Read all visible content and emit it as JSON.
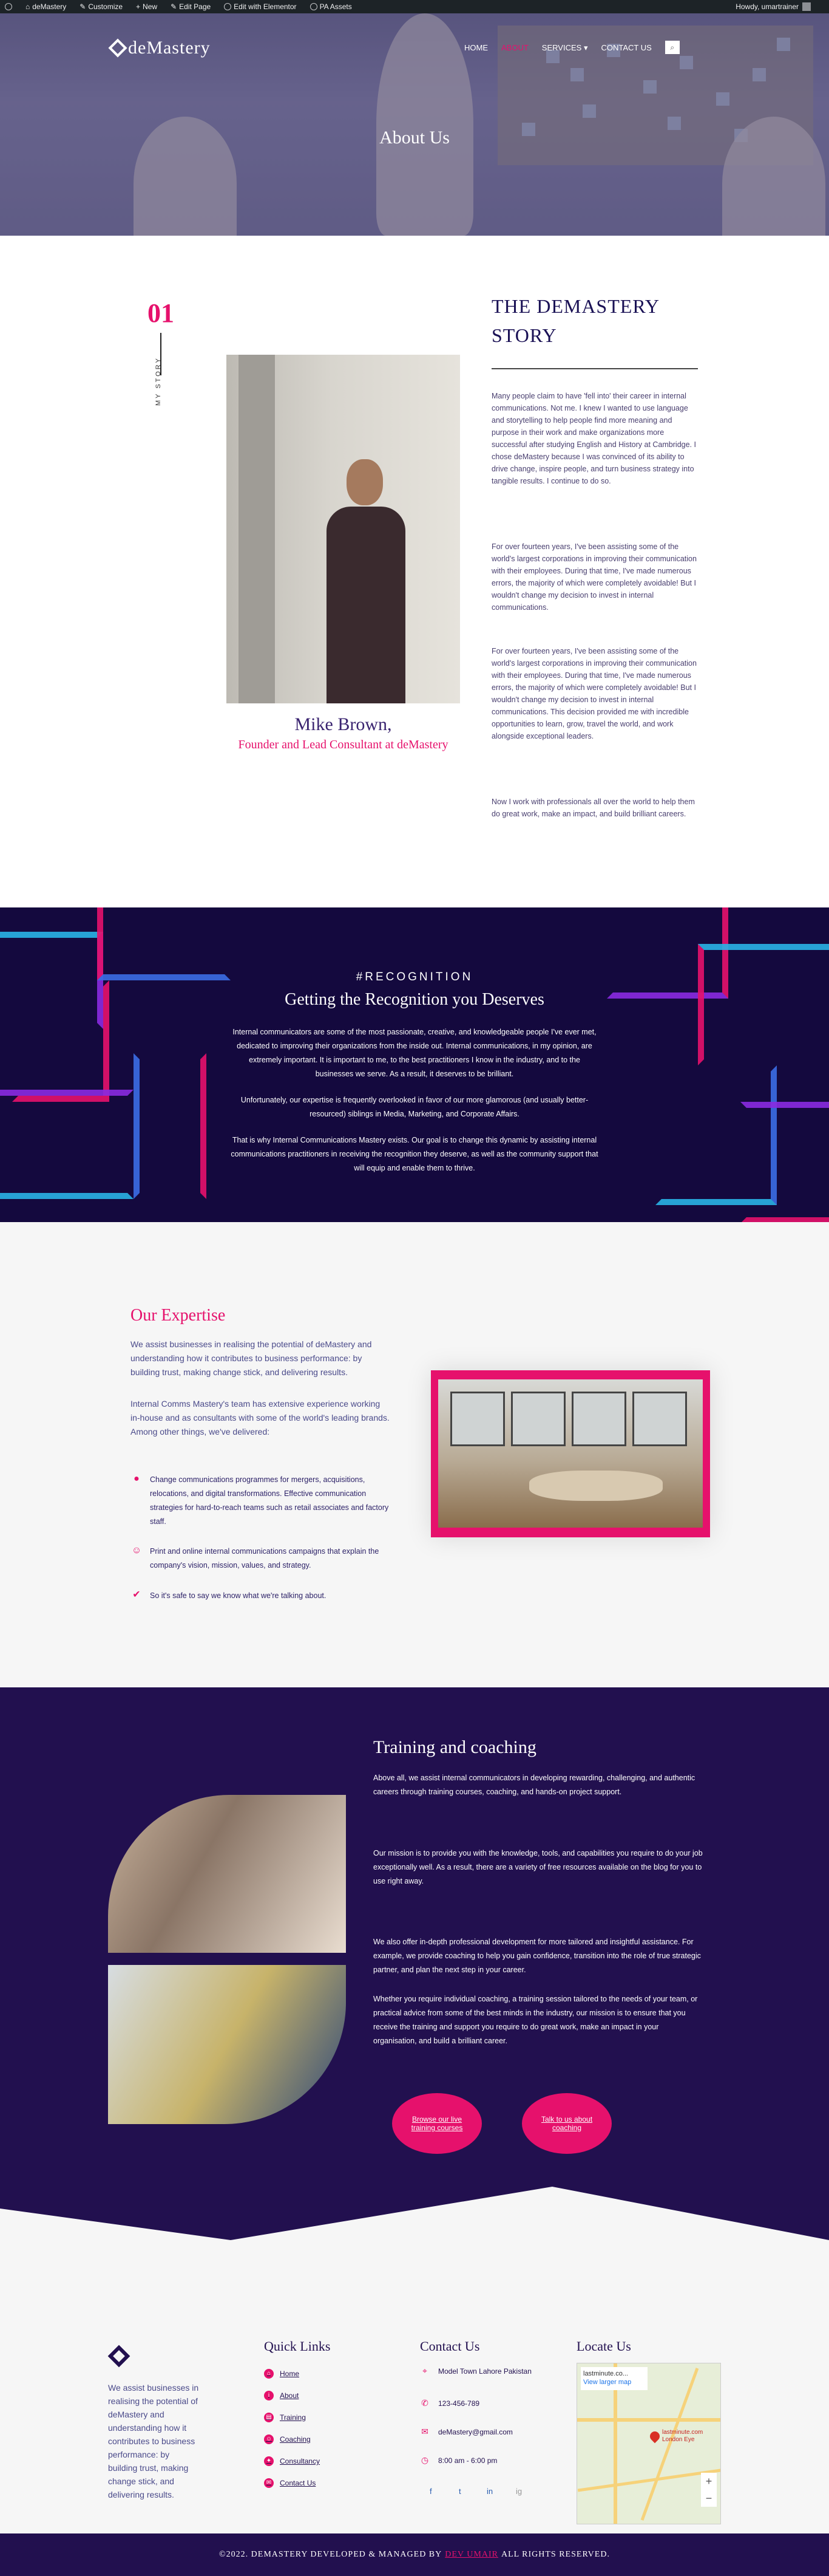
{
  "adminbar": {
    "site": "deMastery",
    "customize": "Customize",
    "new": "New",
    "edit_page": "Edit Page",
    "edit_elementor": "Edit with Elementor",
    "pa_assets": "PA Assets",
    "howdy": "Howdy, umartrainer"
  },
  "header": {
    "logo": "deMastery",
    "nav": [
      "HOME",
      "ABOUT",
      "SERVICES",
      "CONTACT US"
    ],
    "hero_title": "About Us"
  },
  "story": {
    "number": "01",
    "vertical_label": "MY STORY",
    "name": "Mike Brown,",
    "role": "Founder and Lead Consultant at deMastery",
    "heading": "THE DEMASTERY STORY",
    "paragraphs": [
      "Many people claim to have 'fell into' their career in internal communications. Not me. I knew I wanted to use language and storytelling to help people find more meaning and purpose in their work and make organizations more successful after studying English and History at Cambridge. I chose deMastery because I was convinced of its ability to drive change, inspire people, and turn business strategy into tangible results. I continue to do so.",
      "For over fourteen years, I've been assisting some of the world's largest corporations in improving their communication with their employees. During that time, I've made numerous errors, the majority of which were completely avoidable! But I wouldn't change my decision to invest in internal communications.",
      "For over fourteen years, I've been assisting some of the world's largest corporations in improving their communication with their employees. During that time, I've made numerous errors, the majority of which were completely avoidable! But I wouldn't change my decision to invest in internal communications. This decision provided me with incredible opportunities to learn, grow, travel the world, and work alongside exceptional leaders.",
      "Now I work with professionals all over the world to help them do great work, make an impact, and build brilliant careers."
    ]
  },
  "recognition": {
    "subtitle": "#RECOGNITION",
    "title": "Getting the Recognition you Deserves",
    "paragraphs": [
      "Internal communicators are some of the most passionate, creative, and knowledgeable people I've ever met, dedicated to improving their organizations from the inside out. Internal communications, in my opinion, are extremely important. It is important to me, to the best practitioners I know in the industry, and to the businesses we serve. As a result, it deserves to be brilliant.",
      "Unfortunately, our expertise is frequently overlooked in favor of our more glamorous (and usually better-resourced) siblings in Media, Marketing, and Corporate Affairs.",
      "That is why Internal Communications Mastery exists. Our goal is to change this dynamic by assisting internal communications practitioners in receiving the recognition they deserve, as well as the community support that will equip and enable them to thrive."
    ]
  },
  "expertise": {
    "title": "Our Expertise",
    "paragraphs": [
      "We assist businesses in realising the potential of deMastery and understanding how it contributes to business performance: by building trust, making change stick, and delivering results.",
      "Internal Comms Mastery's team has extensive experience working in-house and as consultants with some of the world's leading brands. Among other things, we've delivered:"
    ],
    "items": [
      {
        "icon": "chat-bubble-icon",
        "text": "Change communications programmes for mergers, acquisitions, relocations, and digital transformations. Effective communication strategies for hard-to-reach teams such as retail associates and factory staff."
      },
      {
        "icon": "smile-icon",
        "text": "Print and online internal communications campaigns that explain the company's vision, mission, values, and strategy."
      },
      {
        "icon": "check-icon",
        "text": "So it's safe to say we know what we're talking about."
      }
    ]
  },
  "training": {
    "title": "Training and coaching",
    "paragraphs": [
      "Above all, we assist internal communicators in developing rewarding, challenging, and authentic careers through training courses, coaching, and hands-on project support.",
      "Our mission is to provide you with the knowledge, tools, and capabilities you require to do your job exceptionally well. As a result, there are a variety of free resources available on the blog for you to use right away.",
      "We also offer in-depth professional development for more tailored and insightful assistance. For example, we provide coaching to help you gain confidence, transition into the role of true strategic partner, and plan the next step in your career.",
      "Whether you require individual coaching, a training session tailored to the needs of your team, or practical advice from some of the best minds in the industry, our mission is to ensure that you receive the training and support you require to do great work, make an impact in your organisation, and build a brilliant career."
    ],
    "buttons": [
      "Browse our live training courses",
      "Talk to us about coaching"
    ]
  },
  "footer": {
    "about": "We assist businesses in realising the potential of deMastery and understanding how it contributes to business performance: by building trust, making change stick, and delivering results.",
    "quick_links_title": "Quick Links",
    "quick_links": [
      "Home",
      "About",
      "Training",
      "Coaching",
      "Consultancy",
      "Contact Us"
    ],
    "contact_title": "Contact Us",
    "contact": [
      "Model Town Lahore Pakistan",
      "123-456-789",
      "deMastery@gmail.com",
      "8:00 am - 6:00 pm"
    ],
    "locate_title": "Locate Us",
    "map": {
      "place": "lastminute.co...",
      "link": "View larger map",
      "pin_label": "lastminute.com London Eye",
      "zoom_in": "+",
      "zoom_out": "−"
    },
    "social": [
      "f",
      "t",
      "in",
      "ig"
    ],
    "copyright_prefix": "©2022. DEMASTERY DEVELOPED & MANAGED BY",
    "copyright_name": "DEV UMAIR",
    "copyright_suffix": "ALL RIGHTS RESERVED."
  },
  "colors": {
    "accent": "#e6116c",
    "navy": "#22104f",
    "dark": "#14093e"
  }
}
